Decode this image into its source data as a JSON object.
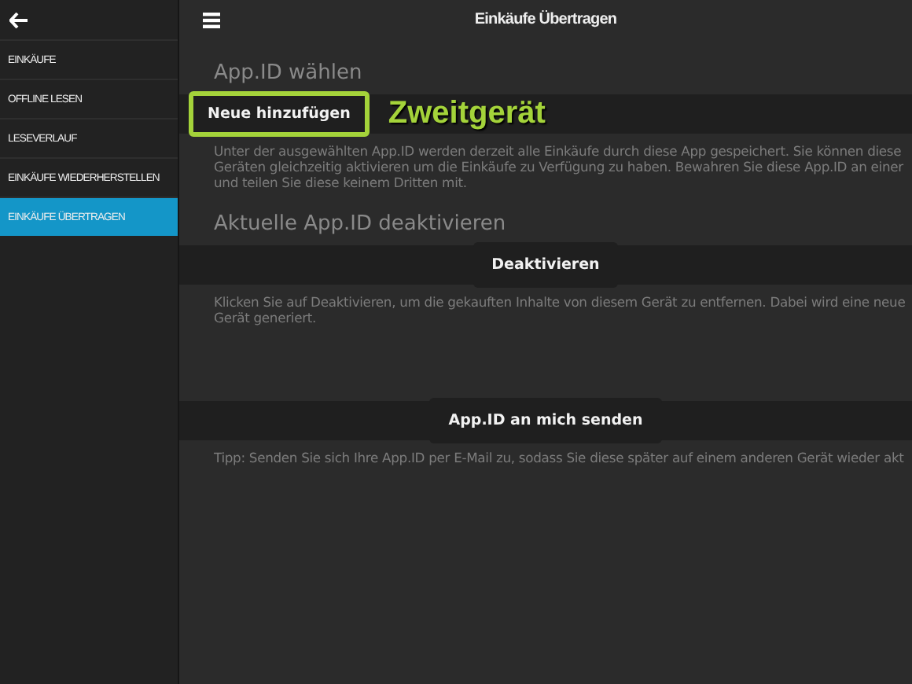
{
  "sidebar": {
    "items": [
      {
        "label": "EINKÄUFE",
        "selected": false
      },
      {
        "label": "OFFLINE LESEN",
        "selected": false
      },
      {
        "label": "LESEVERLAUF",
        "selected": false
      },
      {
        "label": "EINKÄUFE WIEDERHERSTELLEN",
        "selected": false
      },
      {
        "label": "EINKÄUFE ÜBERTRAGEN",
        "selected": true
      }
    ]
  },
  "header": {
    "title": "Einkäufe Übertragen"
  },
  "sections": [
    {
      "title": "App.ID wählen",
      "button": "Neue hinzufügen",
      "kind": "picker",
      "highlighted": true,
      "annotation": "Zweitgerät",
      "lines": [
        "Unter der ausgewählten App.ID werden derzeit alle Einkäufe durch diese App gespeichert. Sie können diese",
        "Geräten gleichzeitig aktivieren um die Einkäufe zu Verfügung zu haben. Bewahren Sie diese App.ID an einer",
        "und teilen Sie diese keinem Dritten mit."
      ]
    },
    {
      "title": "Aktuelle App.ID deaktivieren",
      "button": "Deaktivieren",
      "kind": "action",
      "highlighted": false,
      "lines": [
        "Klicken Sie auf Deaktivieren, um die gekauften Inhalte von diesem Gerät zu entfernen. Dabei wird eine neue",
        "Gerät generiert."
      ]
    },
    {
      "button": "App.ID an mich senden",
      "kind": "action",
      "highlighted": false,
      "lines": [
        "Tipp: Senden Sie sich Ihre App.ID per E-Mail zu, sodass Sie diese später auf einem anderen Gerät wieder akt"
      ]
    }
  ]
}
